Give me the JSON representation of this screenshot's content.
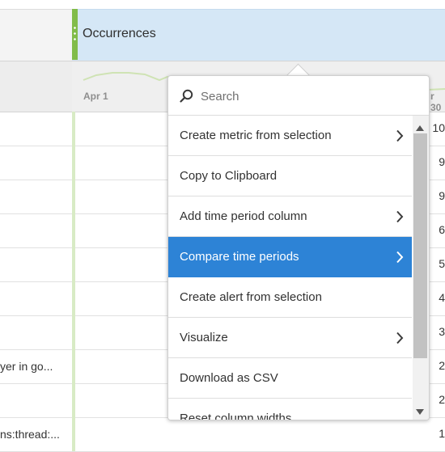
{
  "header": {
    "title": "Occurrences"
  },
  "sparkline": {
    "start_label": "Apr 1",
    "end_label": "r 30",
    "color": "#cfe3b4"
  },
  "rows": [
    {
      "label": "",
      "value": "10"
    },
    {
      "label": "",
      "value": "9"
    },
    {
      "label": "",
      "value": "9"
    },
    {
      "label": "",
      "value": "6"
    },
    {
      "label": "",
      "value": "5"
    },
    {
      "label": "",
      "value": "4"
    },
    {
      "label": "",
      "value": "3"
    },
    {
      "label": "yer in go...",
      "value": "2"
    },
    {
      "label": "",
      "value": "2"
    },
    {
      "label": "ns:thread:...",
      "value": "1"
    }
  ],
  "popover": {
    "search_placeholder": "Search",
    "items": [
      {
        "label": "Create metric from selection",
        "has_submenu": true,
        "active": false
      },
      {
        "label": "Copy to Clipboard",
        "has_submenu": false,
        "active": false
      },
      {
        "label": "Add time period column",
        "has_submenu": true,
        "active": false
      },
      {
        "label": "Compare time periods",
        "has_submenu": true,
        "active": true
      },
      {
        "label": "Create alert from selection",
        "has_submenu": false,
        "active": false
      },
      {
        "label": "Visualize",
        "has_submenu": true,
        "active": false
      },
      {
        "label": "Download as CSV",
        "has_submenu": false,
        "active": false
      },
      {
        "label": "Reset column widths",
        "has_submenu": false,
        "active": false
      }
    ]
  },
  "colors": {
    "accent_green": "#81bc4a",
    "header_blue": "#d5e7f6",
    "active_item": "#2d83d6"
  },
  "icons": {
    "search": "search-icon",
    "chevron": "chevron-right-icon",
    "scroll_up": "scroll-up-arrow-icon",
    "scroll_down": "scroll-down-arrow-icon",
    "drag_handle": "drag-handle-icon"
  }
}
